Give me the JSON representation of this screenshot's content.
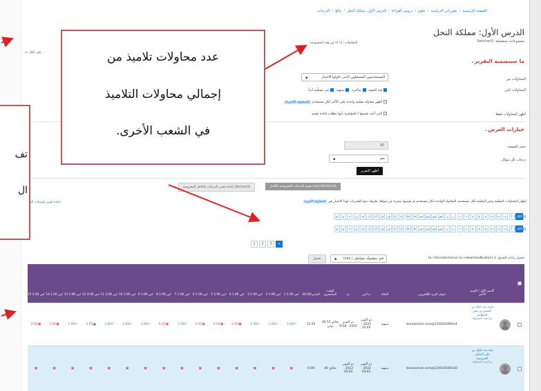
{
  "breadcrumb": [
    "الصفحة الرئيسية",
    "مقرراتي الدراسية",
    "علوم",
    "دروس القراءة",
    "الدرس الأول: مملكة النحل",
    "نتائج",
    "الدرجات"
  ],
  "quiz": {
    "title": "الدرس الأول: مملكة النحل",
    "group_label": "مجموعات منفصلة: Section3",
    "attempts_summary": "المحاولات: ١٤ (٢ من هذه المجموعة)",
    "left_control": "«« على الكل"
  },
  "report_section": {
    "header": "ما سيتضمنه التقرير",
    "attempts_from_label": "المحاولات من",
    "attempts_from_value": "المستخدمون المسجلون الذين حاولوا الاختبار",
    "attempts_that_label": "المحاولات التي",
    "state_options": [
      "قيد التنفيذ",
      "متأخرة",
      "منتهية",
      "غير مسلّمة أبداً"
    ],
    "highest_graded_text": "أظهر محاولة مقيّمة واحدة على الأكثر لكل مستخدم",
    "highest_graded_link": "(المحاولة الأخيرة)",
    "only_graded_label": "أظهر المحاولات فقط",
    "regraded_text": "التي أعيد تقييمها / المؤشرة بأنها تتطلب إعادة تقييم"
  },
  "display_section": {
    "header": "خيارات العرض",
    "page_size_label": "حجم الصفحة",
    "page_size_value": "30",
    "marks_label": "درجات كل سؤال",
    "marks_value": "نعم",
    "show_button": "أظهر التقرير"
  },
  "actions": {
    "regrade_all": "إعادة تقييم الدرجات المعروضة بالكامل (Section3)",
    "dry_run": "إعادة تقدير الدرجات بالكامل المعروضة (Section3)"
  },
  "regrade_note": "إظهار المحاولات المقيّمة وغير المقيّمة لكل مستخدم. المحاولة الواحدة لكل مستخدم تم تقييمها مميزة عن سواها. طريقة دمج التقديرات لهذا الاختبار هي",
  "regrade_note_link": "المحاولة الأخيرة",
  "reset_link": "إعادة تعيين تفضيلات الجدول",
  "letters": [
    "أ",
    "ب",
    "ت",
    "ث",
    "ج",
    "ح",
    "خ",
    "د",
    "ذ",
    "ر",
    "ز",
    "س",
    "ش",
    "ص",
    "ض",
    "ط",
    "ظ",
    "ع",
    "غ",
    "ف",
    "ق",
    "ك",
    "ل",
    "م",
    "ن",
    "ه",
    "و",
    "ي"
  ],
  "letter_rows": {
    "first_label": "الإسم الأول",
    "last_label": "الإسم الأخير",
    "all_label": "الكل"
  },
  "pager": [
    "1",
    "2",
    "3",
    "»"
  ],
  "download": {
    "label": "تحميل بيانات الجدول كـ (a->downloadbutton) (a->formatsmenu)",
    "format_value": "قيم مفصولة بفواصل (.csv)",
    "button": "تحميل"
  },
  "table": {
    "headers": [
      "الاسم الأول / الإسم الأخير",
      "عنوان البريد الإلكتروني",
      "الحالة",
      "بدأ في",
      "تم",
      "الوقت المستغرق",
      "التقدير/20.00",
      "1 س 1.00/",
      "2 س 1.00/",
      "3 س 1.00/",
      "4 س 1.00/",
      "5 س 1.00/",
      "6 س 1.00/",
      "7 س 1.00/",
      "8 س 1.00/",
      "9 س 1.00/",
      "10 س 1.00/",
      "11 س 2.00/",
      "12 س 4.00/",
      "13 س 1.00/",
      "14 س 1.00/",
      "15 س 2.00/"
    ],
    "rows": [
      {
        "name": "فرح بنت عمار بن خميس بن نصر العطابية",
        "review": "مراجعة المحاولة",
        "email": "baraaoman.com@1244201801s4",
        "status": "منتهية",
        "started": "دو أكتوبر 2022 - 10:44",
        "completed": "دو أكتوبر 2022 - 9:58",
        "duration": "26 دقائق 52 ثواني",
        "grade": "11.50",
        "q": [
          "1.00",
          "1.00",
          "1.00",
          "0.00",
          "0.00",
          "0.00",
          "1.00",
          "0.00",
          "1.00",
          "1.00",
          "1.00",
          "2.50",
          "1.00",
          "0.00",
          "0.00"
        ],
        "q_state": [
          "ok",
          "ok",
          "ok",
          "bad",
          "bad",
          "bad",
          "ok",
          "bad",
          "ok",
          "ok",
          "ok",
          "part",
          "ok",
          "bad",
          "bad"
        ]
      },
      {
        "name": "هبة بنت خليل بن علي العداف الحروصية",
        "review": "مراجعة المحاولة",
        "email": "baraaoman.com@1244201801s6",
        "status": "منتهية",
        "started": "دو أكتوبر 2022 - 10:03",
        "completed": "دو أكتوبر 2022 - 10:43",
        "duration": "40 دقائق",
        "grade": "0.00",
        "q": [
          "-",
          "-",
          "-",
          "-",
          "-",
          "-",
          "-",
          "-",
          "-",
          "-",
          "-",
          "-",
          "-",
          "-",
          "-"
        ],
        "q_state": [
          "x",
          "x",
          "x",
          "x",
          "x",
          "x",
          "x",
          "x",
          "x",
          "x",
          "x",
          "x",
          "x",
          "x",
          "x"
        ]
      }
    ]
  },
  "callouts": {
    "main_lines": [
      "عدد محاولات تلاميذ من",
      "إجمالي محاولات التلاميذ",
      "في الشعب الأخرى."
    ],
    "left_fragments": [
      "تف",
      "ال"
    ]
  },
  "colors": {
    "accent": "#1177d1",
    "table_header": "#6b4a8c",
    "callout_border": "#b85a5a",
    "arrow": "#e02020",
    "alert_text": "#c0392b"
  }
}
